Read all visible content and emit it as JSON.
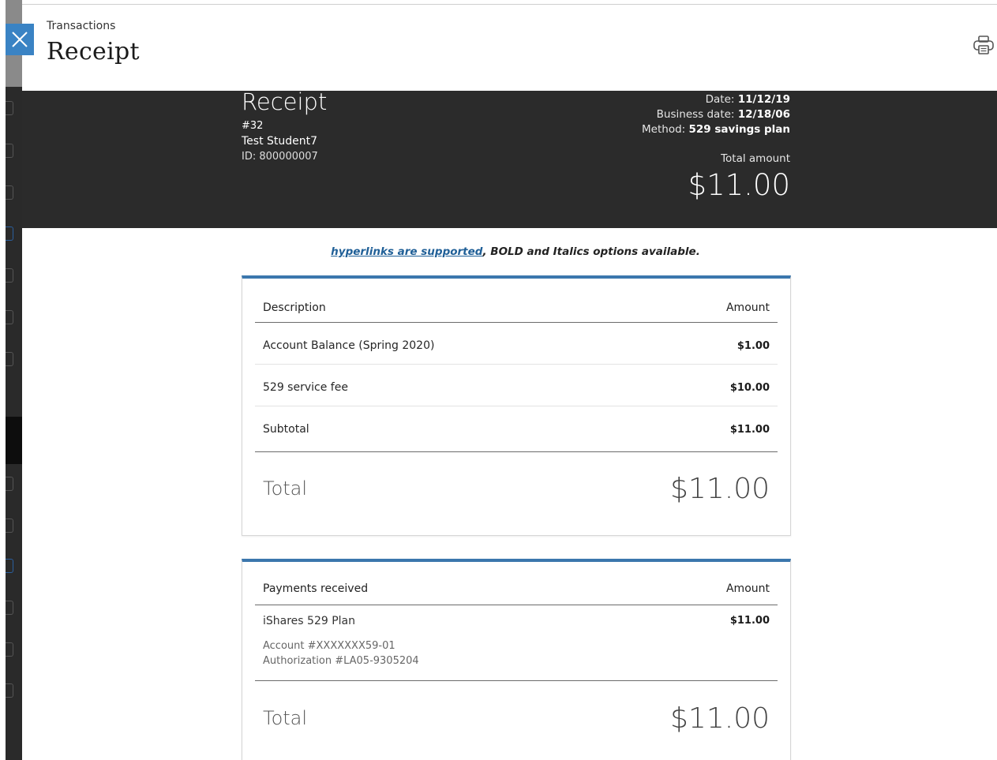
{
  "header": {
    "breadcrumb": "Transactions",
    "title": "Receipt"
  },
  "icons": {
    "close": "close-icon",
    "print": "printer-icon"
  },
  "receipt": {
    "title": "Receipt",
    "number": "#32",
    "student_name": "Test Student7",
    "student_id": "ID: 800000007",
    "date_label": "Date:",
    "date_value": "11/12/19",
    "business_date_label": "Business date:",
    "business_date_value": "12/18/06",
    "method_label": "Method:",
    "method_value": "529 savings plan",
    "total_label": "Total amount",
    "total_value": "$11.00"
  },
  "note": {
    "link_text": "hyperlinks are supported",
    "rest_bold": ", BOLD",
    "rest_text": " and Italics options available."
  },
  "charges": {
    "col_description": "Description",
    "col_amount": "Amount",
    "rows": [
      {
        "description": "Account Balance (Spring 2020)",
        "amount": "$1.00"
      },
      {
        "description": "529 service fee",
        "amount": "$10.00"
      }
    ],
    "subtotal_label": "Subtotal",
    "subtotal_value": "$11.00",
    "total_label": "Total",
    "total_value": "$11.00"
  },
  "payments": {
    "col_description": "Payments received",
    "col_amount": "Amount",
    "items": [
      {
        "name": "iShares 529 Plan",
        "account": "Account #XXXXXXX59-01",
        "authorization": "Authorization #LA05-9305204",
        "amount": "$11.00"
      }
    ],
    "total_label": "Total",
    "total_value": "$11.00"
  }
}
